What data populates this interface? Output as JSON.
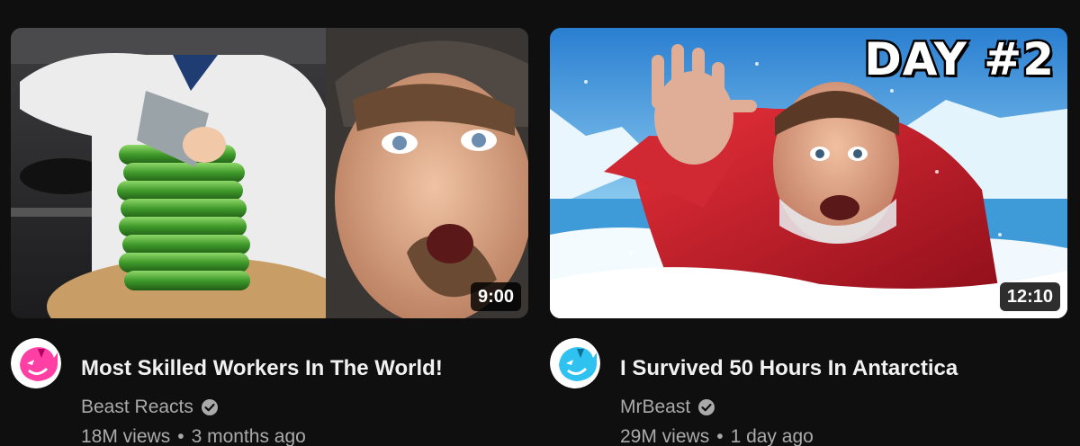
{
  "videos": [
    {
      "title": "Most Skilled Workers In The World!",
      "channel": "Beast Reacts",
      "views": "18M views",
      "age": "3 months ago",
      "duration": "9:00",
      "verified": true,
      "thumbnail_overlay_text": ""
    },
    {
      "title": "I Survived 50 Hours In Antarctica",
      "channel": "MrBeast",
      "views": "29M views",
      "age": "1 day ago",
      "duration": "12:10",
      "verified": true,
      "thumbnail_overlay_text": "DAY #2"
    }
  ],
  "separator": "•",
  "colors": {
    "background": "#0f0f0f",
    "primary_text": "#f1f1f1",
    "secondary_text": "#aaaaaa",
    "beast_reacts_avatar": "#ff3fa4",
    "mrbeast_avatar": "#2fc1f0"
  }
}
